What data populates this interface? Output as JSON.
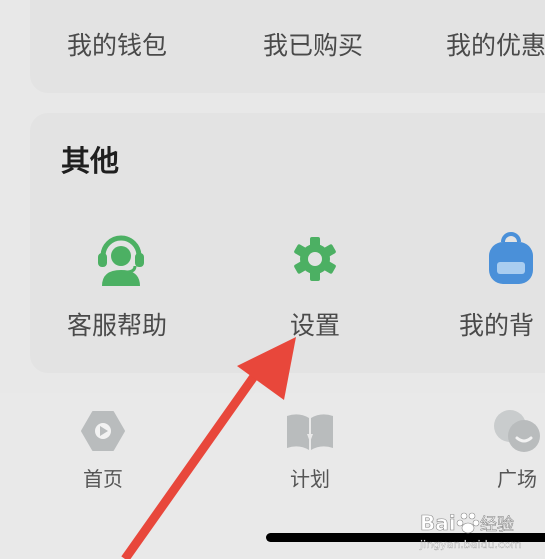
{
  "top_row": {
    "items": [
      {
        "label": "我的钱包",
        "icon": "wallet-icon"
      },
      {
        "label": "我已购买",
        "icon": "purchased-icon"
      },
      {
        "label": "我的优惠",
        "icon": "coupon-icon"
      }
    ]
  },
  "other_section": {
    "title": "其他",
    "items": [
      {
        "label": "客服帮助",
        "icon": "headset-agent-icon"
      },
      {
        "label": "设置",
        "icon": "gear-icon"
      },
      {
        "label": "我的背",
        "icon": "backpack-icon"
      }
    ]
  },
  "tabbar": {
    "tabs": [
      {
        "label": "首页",
        "icon": "play-hexagon-icon"
      },
      {
        "label": "计划",
        "icon": "open-book-icon"
      },
      {
        "label": "广场",
        "icon": "chat-bubbles-icon"
      }
    ]
  },
  "watermark": {
    "brand": "Bai",
    "brand_cn": "经验",
    "url": "jingyan.baidu.com"
  },
  "colors": {
    "accent_green": "#4cb063",
    "backpack_blue": "#4a90d9",
    "arrow_red": "#e8473b",
    "icon_gray": "#b9bcbd"
  }
}
